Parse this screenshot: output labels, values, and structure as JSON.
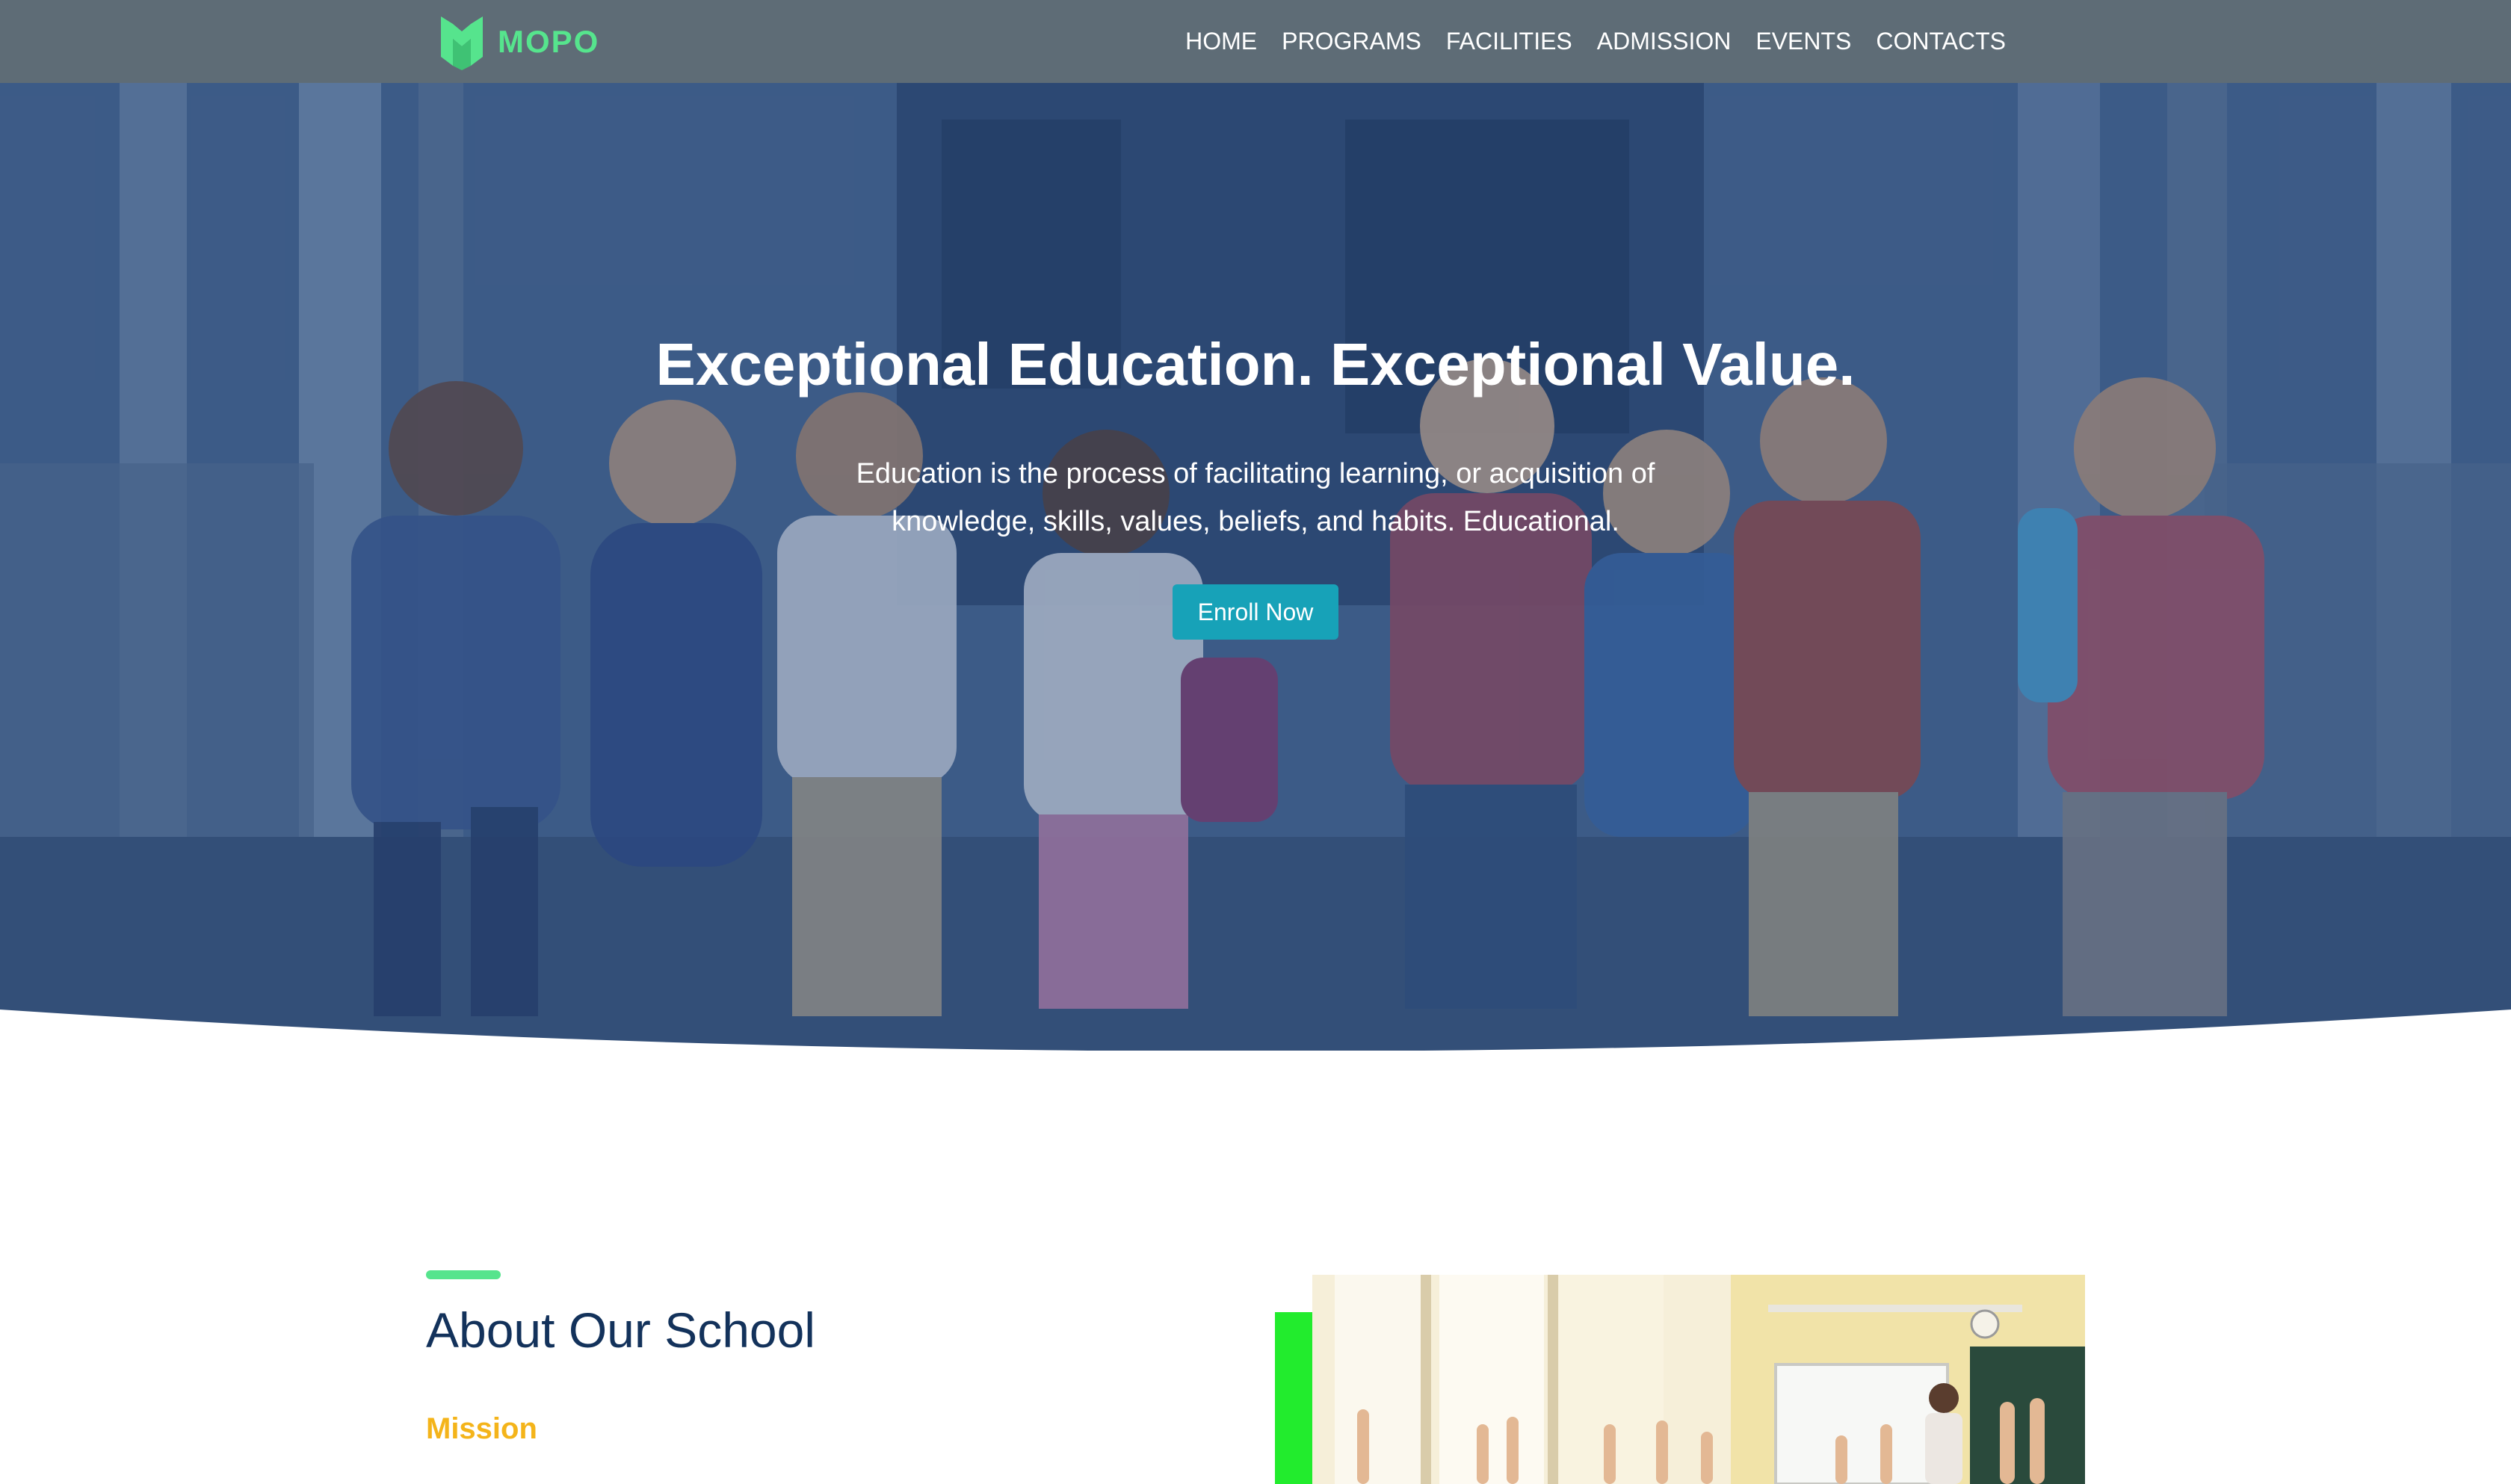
{
  "brand": {
    "name": "MOPO",
    "logo_icon": "m-shield-logo-icon",
    "accent_color": "#56e48d"
  },
  "nav": {
    "items": [
      {
        "label": "HOME"
      },
      {
        "label": "PROGRAMS"
      },
      {
        "label": "FACILITIES"
      },
      {
        "label": "ADMISSION"
      },
      {
        "label": "EVENTS"
      },
      {
        "label": "CONTACTS"
      }
    ]
  },
  "hero": {
    "title": "Exceptional Education. Exceptional Value.",
    "subtitle": "Education is the process of facilitating learning, or acquisition of knowledge, skills, values, beliefs, and habits. Educational.",
    "cta_label": "Enroll Now",
    "cta_color": "#17a2b8"
  },
  "about": {
    "title": "About Our School",
    "mission_label": "Mission",
    "title_color": "#13325b",
    "mission_color": "#f4b41a"
  }
}
